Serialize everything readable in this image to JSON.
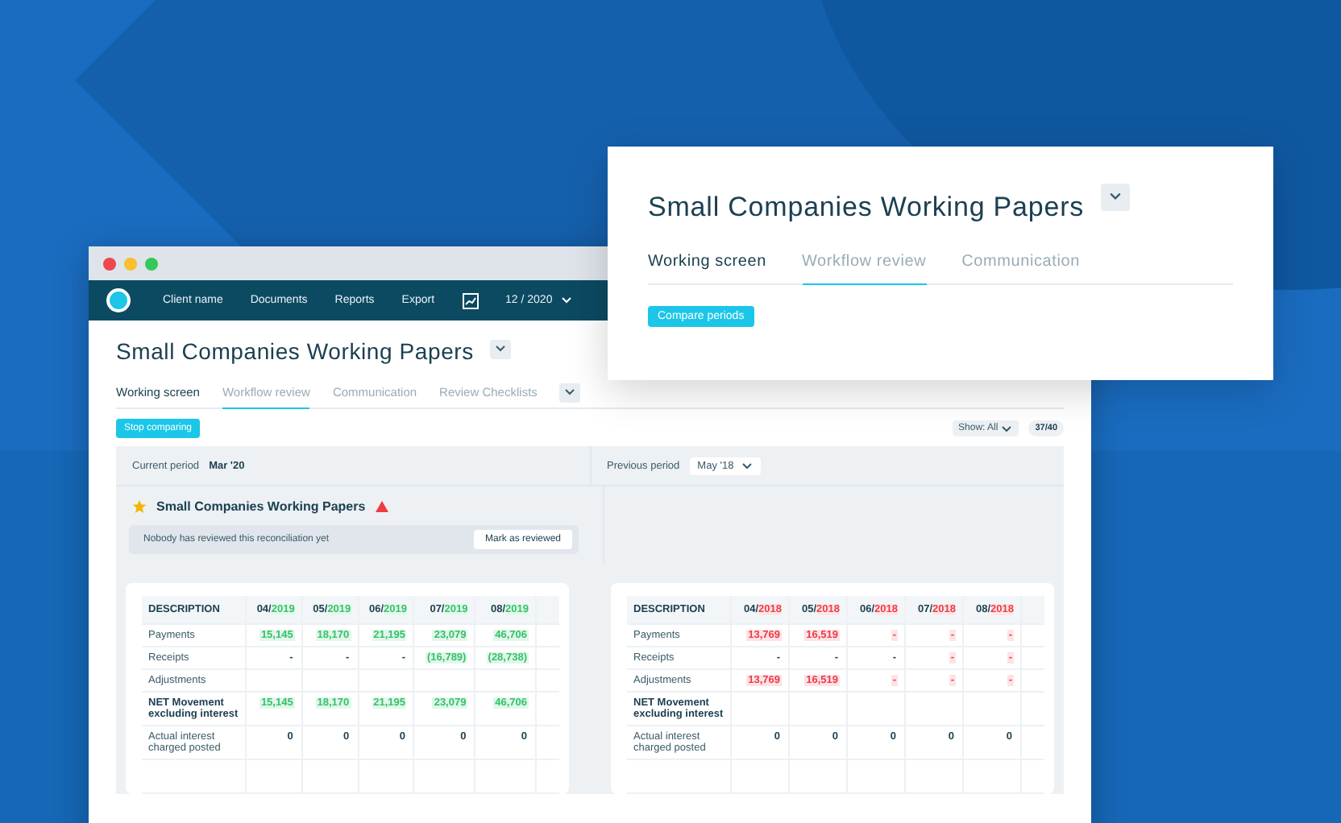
{
  "window": {
    "nav": {
      "items": [
        "Client name",
        "Documents",
        "Reports",
        "Export"
      ],
      "period": "12 / 2020"
    },
    "title": "Small Companies Working Papers",
    "tabs": [
      {
        "label": "Working screen",
        "selected": false,
        "emphasized": true
      },
      {
        "label": "Workflow review",
        "selected": true,
        "emphasized": false
      },
      {
        "label": "Communication",
        "selected": false,
        "emphasized": false
      },
      {
        "label": "Review Checklists",
        "selected": false,
        "emphasized": false
      }
    ],
    "stop_button": "Stop comparing",
    "show_filter": "Show: All",
    "count": "37/40",
    "current_period": {
      "label": "Current period",
      "value": "Mar '20"
    },
    "previous_period": {
      "label": "Previous period",
      "value": "May '18"
    },
    "section": {
      "title": "Small Companies Working Papers",
      "starred": true,
      "warning": true,
      "notice": "Nobody has reviewed this reconciliation yet",
      "action": "Mark as reviewed"
    },
    "tables": [
      {
        "kind": "positive",
        "header": "DESCRIPTION",
        "columns": [
          {
            "month": "04/",
            "year": "2019"
          },
          {
            "month": "05/",
            "year": "2019"
          },
          {
            "month": "06/",
            "year": "2019"
          },
          {
            "month": "07/",
            "year": "2019"
          },
          {
            "month": "08/",
            "year": "2019"
          }
        ],
        "rows": [
          {
            "label": "Payments",
            "bold": false,
            "cells": [
              {
                "text": "15,145",
                "highlight": true
              },
              {
                "text": "18,170",
                "highlight": true
              },
              {
                "text": "21,195",
                "highlight": true
              },
              {
                "text": "23,079",
                "highlight": true
              },
              {
                "text": "46,706",
                "highlight": true
              }
            ]
          },
          {
            "label": "Receipts",
            "bold": false,
            "cells": [
              {
                "text": "-",
                "highlight": false
              },
              {
                "text": "-",
                "highlight": false
              },
              {
                "text": "-",
                "highlight": false
              },
              {
                "text": "(16,789)",
                "highlight": true
              },
              {
                "text": "(28,738)",
                "highlight": true
              }
            ]
          },
          {
            "label": "Adjustments",
            "bold": false,
            "cells": []
          },
          {
            "label": "NET Movement excluding interest",
            "bold": true,
            "cells": [
              {
                "text": "15,145",
                "highlight": true
              },
              {
                "text": "18,170",
                "highlight": true
              },
              {
                "text": "21,195",
                "highlight": true
              },
              {
                "text": "23,079",
                "highlight": true
              },
              {
                "text": "46,706",
                "highlight": true
              }
            ]
          },
          {
            "label": "Actual interest charged posted",
            "bold": false,
            "cells": [
              {
                "text": "0",
                "highlight": false
              },
              {
                "text": "0",
                "highlight": false
              },
              {
                "text": "0",
                "highlight": false
              },
              {
                "text": "0",
                "highlight": false
              },
              {
                "text": "0",
                "highlight": false
              }
            ]
          }
        ]
      },
      {
        "kind": "negative",
        "header": "DESCRIPTION",
        "columns": [
          {
            "month": "04/",
            "year": "2018"
          },
          {
            "month": "05/",
            "year": "2018"
          },
          {
            "month": "06/",
            "year": "2018"
          },
          {
            "month": "07/",
            "year": "2018"
          },
          {
            "month": "08/",
            "year": "2018"
          }
        ],
        "rows": [
          {
            "label": "Payments",
            "bold": false,
            "cells": [
              {
                "text": "13,769",
                "highlight": true
              },
              {
                "text": "16,519",
                "highlight": true
              },
              {
                "text": "-",
                "highlight": true
              },
              {
                "text": "-",
                "highlight": true
              },
              {
                "text": "-",
                "highlight": true
              }
            ]
          },
          {
            "label": "Receipts",
            "bold": false,
            "cells": [
              {
                "text": "-",
                "highlight": false
              },
              {
                "text": "-",
                "highlight": false
              },
              {
                "text": "-",
                "highlight": false
              },
              {
                "text": "-",
                "highlight": true
              },
              {
                "text": "-",
                "highlight": true
              }
            ]
          },
          {
            "label": "Adjustments",
            "bold": false,
            "cells": [
              {
                "text": "13,769",
                "highlight": true
              },
              {
                "text": "16,519",
                "highlight": true
              },
              {
                "text": "-",
                "highlight": true
              },
              {
                "text": "-",
                "highlight": true
              },
              {
                "text": "-",
                "highlight": true
              }
            ]
          },
          {
            "label": "NET Movement excluding interest",
            "bold": true,
            "cells": []
          },
          {
            "label": "Actual interest charged posted",
            "bold": false,
            "cells": [
              {
                "text": "0",
                "highlight": false
              },
              {
                "text": "0",
                "highlight": false
              },
              {
                "text": "0",
                "highlight": false
              },
              {
                "text": "0",
                "highlight": false
              },
              {
                "text": "0",
                "highlight": false
              }
            ]
          }
        ]
      }
    ]
  },
  "popup": {
    "title": "Small Companies Working Papers",
    "tabs": [
      {
        "label": "Working screen",
        "selected": false,
        "emphasized": true
      },
      {
        "label": "Workflow review",
        "selected": true,
        "emphasized": false
      },
      {
        "label": "Communication",
        "selected": false,
        "emphasized": false
      }
    ],
    "button": "Compare periods"
  }
}
